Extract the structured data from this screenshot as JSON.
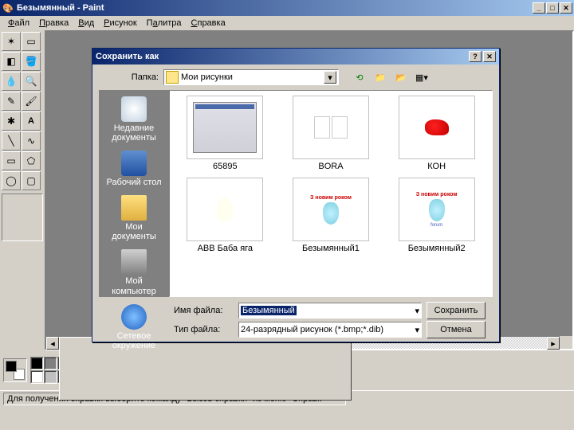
{
  "window": {
    "title": "Безымянный - Paint"
  },
  "menu": {
    "file": "Файл",
    "edit": "Правка",
    "view": "Вид",
    "image": "Рисунок",
    "colors": "Палитра",
    "help": "Справка"
  },
  "status": {
    "help": "Для получения справки выберите команду \"Вызов справки\" из меню \"Справк"
  },
  "palette": {
    "row1": [
      "#000000",
      "#808080",
      "#800000",
      "#808000",
      "#008000",
      "#008080",
      "#000080",
      "#800080",
      "#808040",
      "#004040",
      "#0080ff",
      "#004080",
      "#8000ff",
      "#804000"
    ],
    "row2": [
      "#ffffff",
      "#c0c0c0",
      "#ff0000",
      "#ffff00",
      "#00ff00",
      "#00ffff",
      "#0000ff",
      "#ff00ff",
      "#ffff80",
      "#00ff80",
      "#80ffff",
      "#8080ff",
      "#ff0080",
      "#ff8040"
    ]
  },
  "dialog": {
    "title": "Сохранить как",
    "folder_label": "Папка:",
    "folder_value": "Мои рисунки",
    "places": {
      "recent": "Недавние документы",
      "desktop": "Рабочий стол",
      "mydocs": "Мои документы",
      "mycomp": "Мой компьютер",
      "network": "Сетевое окружение"
    },
    "files": [
      {
        "name": "65895",
        "kind": "screenshot"
      },
      {
        "name": "BORA",
        "kind": "bora"
      },
      {
        "name": "КОН",
        "kind": "kon"
      },
      {
        "name": "АВВ Баба яга",
        "kind": "baba"
      },
      {
        "name": "Безымянный1",
        "kind": "snow1",
        "text": "З новим роком"
      },
      {
        "name": "Безымянный2",
        "kind": "snow2",
        "text": "З новим роком",
        "caption": "forum"
      }
    ],
    "filename_label": "Имя файла:",
    "filename_value": "Безымянный",
    "filetype_label": "Тип файла:",
    "filetype_value": "24-разрядный рисунок (*.bmp;*.dib)",
    "save_btn": "Сохранить",
    "cancel_btn": "Отмена"
  }
}
